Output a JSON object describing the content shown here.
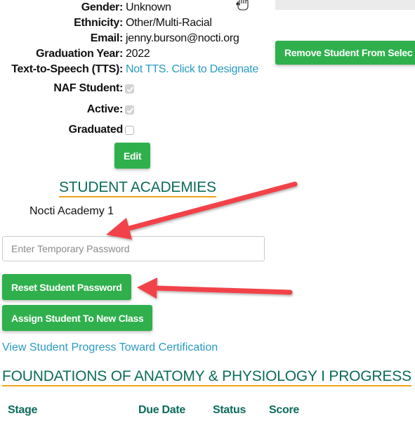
{
  "student_info": {
    "rows": [
      {
        "label": "Gender:",
        "value": "Unknown"
      },
      {
        "label": "Ethnicity:",
        "value": "Other/Multi-Racial"
      },
      {
        "label": "Email:",
        "value": "jenny.burson@nocti.org"
      },
      {
        "label": "Graduation Year:",
        "value": "2022"
      },
      {
        "label": "Text-to-Speech (TTS):",
        "value": "Not TTS. Click to Designate"
      }
    ],
    "checkboxes": [
      {
        "label": "NAF Student:",
        "checked": true
      },
      {
        "label": "Active:",
        "checked": true
      },
      {
        "label": "Graduated",
        "checked": false
      }
    ],
    "edit_label": "Edit"
  },
  "right_panel": {
    "remove_button_label": "Remove Student From Selec"
  },
  "academies": {
    "title": "STUDENT ACADEMIES",
    "items": [
      "Nocti Academy 1"
    ]
  },
  "password": {
    "placeholder": "Enter Temporary Password",
    "value": "",
    "reset_label": "Reset Student Password"
  },
  "assign_label": "Assign Student To New Class",
  "progress_link": "View Student Progress Toward Certification",
  "progress_section": {
    "title": "FOUNDATIONS OF ANATOMY & PHYSIOLOGY I PROGRESS",
    "columns": [
      "Stage",
      "Due Date",
      "Status",
      "Score"
    ]
  },
  "colors": {
    "button_green": "#2fb04d",
    "heading_teal": "#0d6b5c",
    "underline_orange": "#f0a51c",
    "link_blue": "#2a9bc2",
    "annotation_red": "#f2434a"
  },
  "annotations": {
    "arrows": [
      "points-to-password-input",
      "points-to-reset-password-button"
    ]
  }
}
